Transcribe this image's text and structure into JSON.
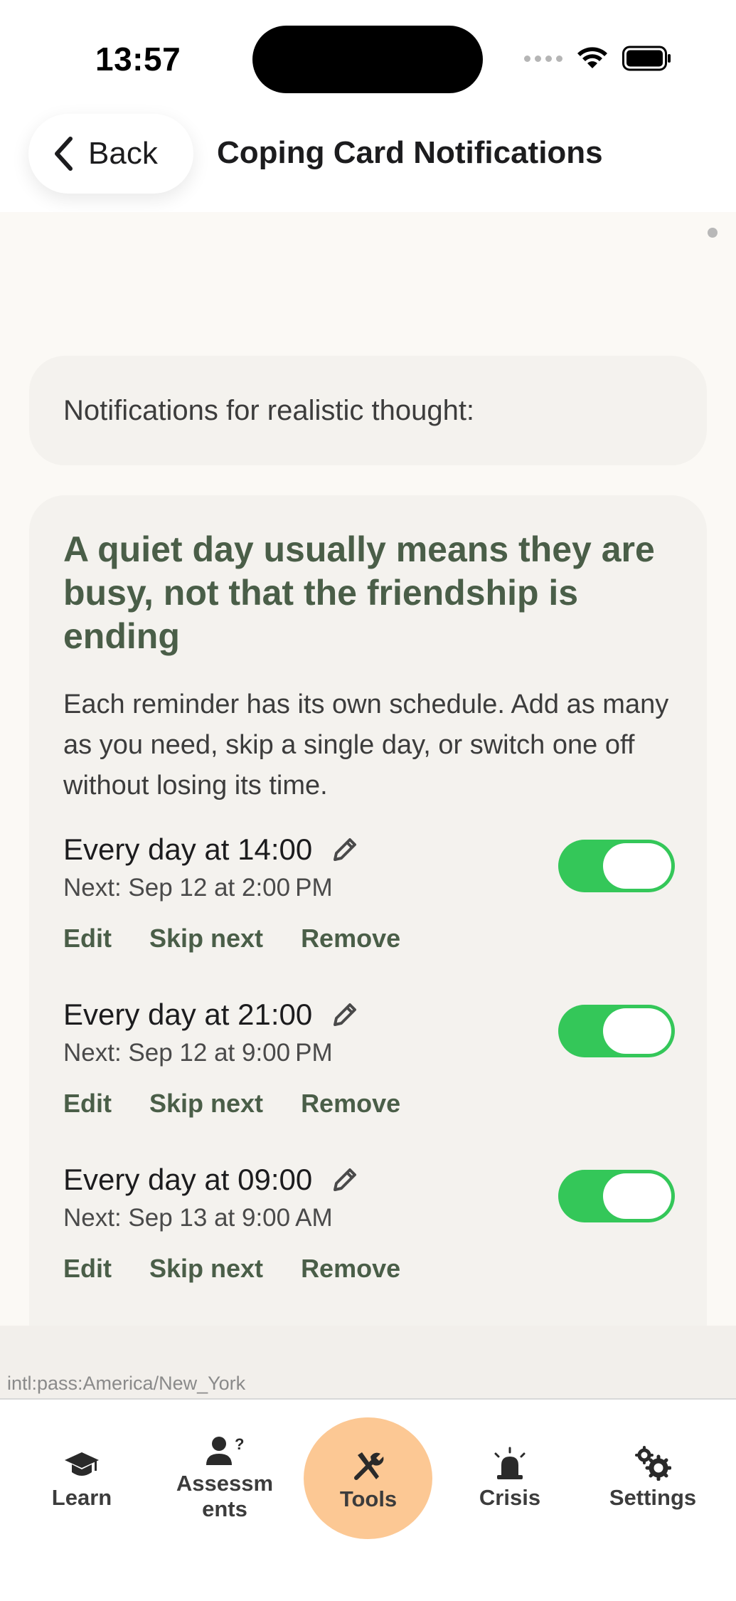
{
  "status": {
    "time": "13:57"
  },
  "header": {
    "back_label": "Back",
    "title": "Coping Card Notifications"
  },
  "content": {
    "label": "Notifications for realistic thought:",
    "thought": "A quiet day usually means they are busy, not that the friendship is ending",
    "description": "Each reminder has its own schedule. Add as many as you need, skip a single day, or switch one off without losing its time.",
    "reminders": [
      {
        "title": "Every day at 14:00",
        "next": "Next: Sep 12 at 2:00 PM",
        "enabled": true
      },
      {
        "title": "Every day at 21:00",
        "next": "Next: Sep 12 at 9:00 PM",
        "enabled": true
      },
      {
        "title": "Every day at 09:00",
        "next": "Next: Sep 13 at 9:00 AM",
        "enabled": true
      }
    ],
    "actions": {
      "edit": "Edit",
      "skip": "Skip next",
      "remove": "Remove"
    }
  },
  "timezone_label": "intl:pass:America/New_York",
  "tabs": [
    {
      "label": "Learn",
      "icon": "graduation-cap-icon"
    },
    {
      "label": "Assessm\nents",
      "icon": "user-question-icon"
    },
    {
      "label": "Tools",
      "icon": "tools-icon",
      "active": true
    },
    {
      "label": "Crisis",
      "icon": "siren-icon"
    },
    {
      "label": "Settings",
      "icon": "gears-icon"
    }
  ],
  "colors": {
    "accent_green": "#4a5e48",
    "toggle_on": "#34c759",
    "active_tab": "#fcc894",
    "background": "#fbf9f5",
    "card": "#f4f2ee"
  }
}
